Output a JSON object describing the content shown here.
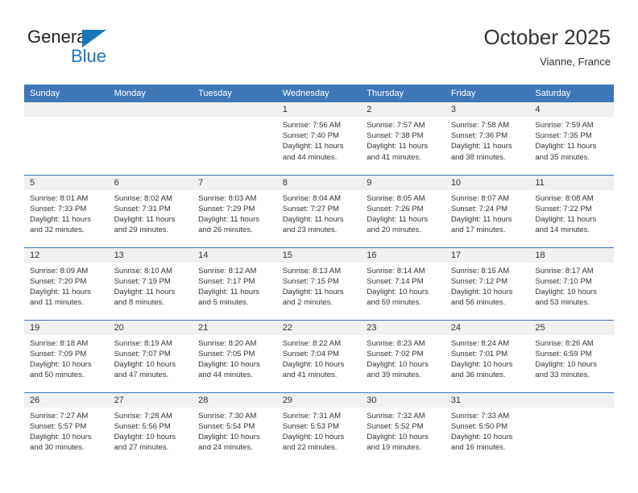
{
  "brand": {
    "name_part1": "General",
    "name_part2": "Blue",
    "triangle_icon": "triangle-icon",
    "accent_color": "#1b75bb"
  },
  "header": {
    "month_title": "October 2025",
    "location": "Vianne, France"
  },
  "calendar": {
    "header_bg": "#3d77b8",
    "daynum_bg": "#f0f0f0",
    "weekday_headers": [
      "Sunday",
      "Monday",
      "Tuesday",
      "Wednesday",
      "Thursday",
      "Friday",
      "Saturday"
    ],
    "labels": {
      "sunrise": "Sunrise:",
      "sunset": "Sunset:",
      "daylight": "Daylight:"
    },
    "weeks": [
      [
        {
          "day": "",
          "empty": true
        },
        {
          "day": "",
          "empty": true
        },
        {
          "day": "",
          "empty": true
        },
        {
          "day": "1",
          "sunrise": "Sunrise: 7:56 AM",
          "sunset": "Sunset: 7:40 PM",
          "daylight_line1": "Daylight: 11 hours",
          "daylight_line2": "and 44 minutes."
        },
        {
          "day": "2",
          "sunrise": "Sunrise: 7:57 AM",
          "sunset": "Sunset: 7:38 PM",
          "daylight_line1": "Daylight: 11 hours",
          "daylight_line2": "and 41 minutes."
        },
        {
          "day": "3",
          "sunrise": "Sunrise: 7:58 AM",
          "sunset": "Sunset: 7:36 PM",
          "daylight_line1": "Daylight: 11 hours",
          "daylight_line2": "and 38 minutes."
        },
        {
          "day": "4",
          "sunrise": "Sunrise: 7:59 AM",
          "sunset": "Sunset: 7:35 PM",
          "daylight_line1": "Daylight: 11 hours",
          "daylight_line2": "and 35 minutes."
        }
      ],
      [
        {
          "day": "5",
          "sunrise": "Sunrise: 8:01 AM",
          "sunset": "Sunset: 7:33 PM",
          "daylight_line1": "Daylight: 11 hours",
          "daylight_line2": "and 32 minutes."
        },
        {
          "day": "6",
          "sunrise": "Sunrise: 8:02 AM",
          "sunset": "Sunset: 7:31 PM",
          "daylight_line1": "Daylight: 11 hours",
          "daylight_line2": "and 29 minutes."
        },
        {
          "day": "7",
          "sunrise": "Sunrise: 8:03 AM",
          "sunset": "Sunset: 7:29 PM",
          "daylight_line1": "Daylight: 11 hours",
          "daylight_line2": "and 26 minutes."
        },
        {
          "day": "8",
          "sunrise": "Sunrise: 8:04 AM",
          "sunset": "Sunset: 7:27 PM",
          "daylight_line1": "Daylight: 11 hours",
          "daylight_line2": "and 23 minutes."
        },
        {
          "day": "9",
          "sunrise": "Sunrise: 8:05 AM",
          "sunset": "Sunset: 7:26 PM",
          "daylight_line1": "Daylight: 11 hours",
          "daylight_line2": "and 20 minutes."
        },
        {
          "day": "10",
          "sunrise": "Sunrise: 8:07 AM",
          "sunset": "Sunset: 7:24 PM",
          "daylight_line1": "Daylight: 11 hours",
          "daylight_line2": "and 17 minutes."
        },
        {
          "day": "11",
          "sunrise": "Sunrise: 8:08 AM",
          "sunset": "Sunset: 7:22 PM",
          "daylight_line1": "Daylight: 11 hours",
          "daylight_line2": "and 14 minutes."
        }
      ],
      [
        {
          "day": "12",
          "sunrise": "Sunrise: 8:09 AM",
          "sunset": "Sunset: 7:20 PM",
          "daylight_line1": "Daylight: 11 hours",
          "daylight_line2": "and 11 minutes."
        },
        {
          "day": "13",
          "sunrise": "Sunrise: 8:10 AM",
          "sunset": "Sunset: 7:19 PM",
          "daylight_line1": "Daylight: 11 hours",
          "daylight_line2": "and 8 minutes."
        },
        {
          "day": "14",
          "sunrise": "Sunrise: 8:12 AM",
          "sunset": "Sunset: 7:17 PM",
          "daylight_line1": "Daylight: 11 hours",
          "daylight_line2": "and 5 minutes."
        },
        {
          "day": "15",
          "sunrise": "Sunrise: 8:13 AM",
          "sunset": "Sunset: 7:15 PM",
          "daylight_line1": "Daylight: 11 hours",
          "daylight_line2": "and 2 minutes."
        },
        {
          "day": "16",
          "sunrise": "Sunrise: 8:14 AM",
          "sunset": "Sunset: 7:14 PM",
          "daylight_line1": "Daylight: 10 hours",
          "daylight_line2": "and 59 minutes."
        },
        {
          "day": "17",
          "sunrise": "Sunrise: 8:15 AM",
          "sunset": "Sunset: 7:12 PM",
          "daylight_line1": "Daylight: 10 hours",
          "daylight_line2": "and 56 minutes."
        },
        {
          "day": "18",
          "sunrise": "Sunrise: 8:17 AM",
          "sunset": "Sunset: 7:10 PM",
          "daylight_line1": "Daylight: 10 hours",
          "daylight_line2": "and 53 minutes."
        }
      ],
      [
        {
          "day": "19",
          "sunrise": "Sunrise: 8:18 AM",
          "sunset": "Sunset: 7:09 PM",
          "daylight_line1": "Daylight: 10 hours",
          "daylight_line2": "and 50 minutes."
        },
        {
          "day": "20",
          "sunrise": "Sunrise: 8:19 AM",
          "sunset": "Sunset: 7:07 PM",
          "daylight_line1": "Daylight: 10 hours",
          "daylight_line2": "and 47 minutes."
        },
        {
          "day": "21",
          "sunrise": "Sunrise: 8:20 AM",
          "sunset": "Sunset: 7:05 PM",
          "daylight_line1": "Daylight: 10 hours",
          "daylight_line2": "and 44 minutes."
        },
        {
          "day": "22",
          "sunrise": "Sunrise: 8:22 AM",
          "sunset": "Sunset: 7:04 PM",
          "daylight_line1": "Daylight: 10 hours",
          "daylight_line2": "and 41 minutes."
        },
        {
          "day": "23",
          "sunrise": "Sunrise: 8:23 AM",
          "sunset": "Sunset: 7:02 PM",
          "daylight_line1": "Daylight: 10 hours",
          "daylight_line2": "and 39 minutes."
        },
        {
          "day": "24",
          "sunrise": "Sunrise: 8:24 AM",
          "sunset": "Sunset: 7:01 PM",
          "daylight_line1": "Daylight: 10 hours",
          "daylight_line2": "and 36 minutes."
        },
        {
          "day": "25",
          "sunrise": "Sunrise: 8:26 AM",
          "sunset": "Sunset: 6:59 PM",
          "daylight_line1": "Daylight: 10 hours",
          "daylight_line2": "and 33 minutes."
        }
      ],
      [
        {
          "day": "26",
          "sunrise": "Sunrise: 7:27 AM",
          "sunset": "Sunset: 5:57 PM",
          "daylight_line1": "Daylight: 10 hours",
          "daylight_line2": "and 30 minutes."
        },
        {
          "day": "27",
          "sunrise": "Sunrise: 7:28 AM",
          "sunset": "Sunset: 5:56 PM",
          "daylight_line1": "Daylight: 10 hours",
          "daylight_line2": "and 27 minutes."
        },
        {
          "day": "28",
          "sunrise": "Sunrise: 7:30 AM",
          "sunset": "Sunset: 5:54 PM",
          "daylight_line1": "Daylight: 10 hours",
          "daylight_line2": "and 24 minutes."
        },
        {
          "day": "29",
          "sunrise": "Sunrise: 7:31 AM",
          "sunset": "Sunset: 5:53 PM",
          "daylight_line1": "Daylight: 10 hours",
          "daylight_line2": "and 22 minutes."
        },
        {
          "day": "30",
          "sunrise": "Sunrise: 7:32 AM",
          "sunset": "Sunset: 5:52 PM",
          "daylight_line1": "Daylight: 10 hours",
          "daylight_line2": "and 19 minutes."
        },
        {
          "day": "31",
          "sunrise": "Sunrise: 7:33 AM",
          "sunset": "Sunset: 5:50 PM",
          "daylight_line1": "Daylight: 10 hours",
          "daylight_line2": "and 16 minutes."
        },
        {
          "day": "",
          "empty": true
        }
      ]
    ]
  }
}
